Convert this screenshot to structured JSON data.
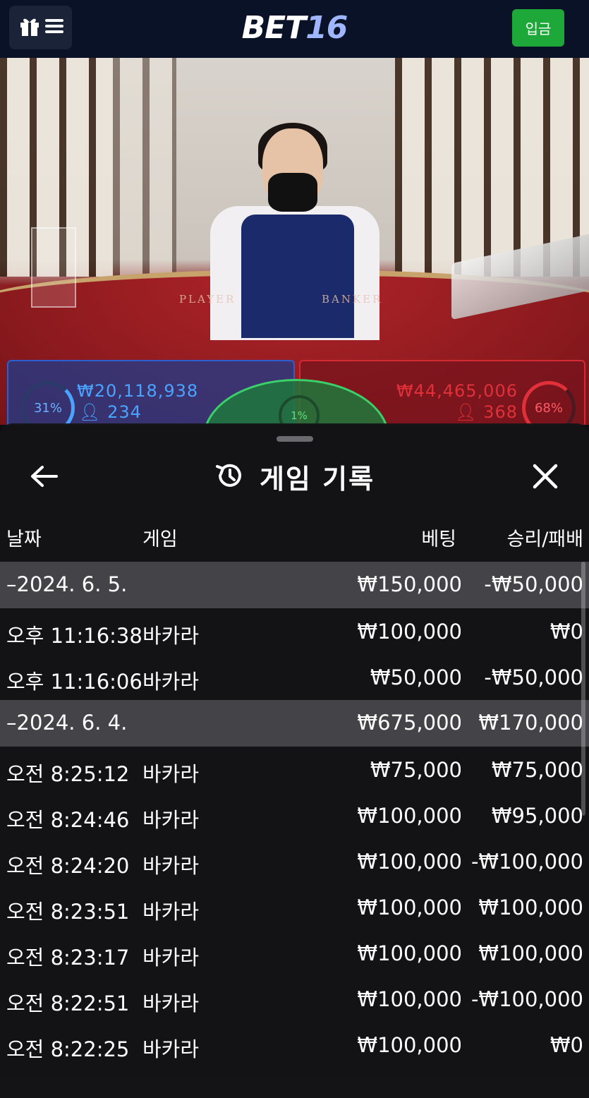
{
  "header": {
    "logo_text": "BET",
    "logo_num": "16",
    "deposit_label": "입금",
    "menu_icons": [
      "gift-icon",
      "hamburger-icon"
    ]
  },
  "video": {
    "table_player_text": "PLAYER",
    "table_banker_text": "BANKER",
    "player": {
      "percent": "31%",
      "amount": "₩20,118,938",
      "count": "234"
    },
    "banker": {
      "percent": "68%",
      "amount": "₩44,465,006",
      "count": "368"
    },
    "tie": {
      "percent": "1%"
    }
  },
  "modal": {
    "title": "게임 기록",
    "columns": {
      "date": "날짜",
      "game": "게임",
      "bet": "베팅",
      "result": "승리/패배"
    },
    "rows": [
      {
        "type": "date",
        "time": "–2024. 6. 5.",
        "game": "",
        "bet": "₩150,000",
        "result": "-₩50,000"
      },
      {
        "type": "item",
        "time": "오후 11:16:38",
        "game": "바카라",
        "bet": "₩100,000",
        "result": "₩0"
      },
      {
        "type": "item",
        "time": "오후 11:16:06",
        "game": "바카라",
        "bet": "₩50,000",
        "result": "-₩50,000"
      },
      {
        "type": "date",
        "time": "–2024. 6. 4.",
        "game": "",
        "bet": "₩675,000",
        "result": "₩170,000"
      },
      {
        "type": "item",
        "time": "오전 8:25:12",
        "game": "바카라",
        "bet": "₩75,000",
        "result": "₩75,000"
      },
      {
        "type": "item",
        "time": "오전 8:24:46",
        "game": "바카라",
        "bet": "₩100,000",
        "result": "₩95,000"
      },
      {
        "type": "item",
        "time": "오전 8:24:20",
        "game": "바카라",
        "bet": "₩100,000",
        "result": "-₩100,000"
      },
      {
        "type": "item",
        "time": "오전 8:23:51",
        "game": "바카라",
        "bet": "₩100,000",
        "result": "₩100,000"
      },
      {
        "type": "item",
        "time": "오전 8:23:17",
        "game": "바카라",
        "bet": "₩100,000",
        "result": "₩100,000"
      },
      {
        "type": "item",
        "time": "오전 8:22:51",
        "game": "바카라",
        "bet": "₩100,000",
        "result": "-₩100,000"
      },
      {
        "type": "item",
        "time": "오전 8:22:25",
        "game": "바카라",
        "bet": "₩100,000",
        "result": "₩0"
      }
    ]
  },
  "colors": {
    "topbar": "#0a1228",
    "deposit_green": "#1ea83a",
    "player_blue": "#2d5fd0",
    "banker_red": "#d42a33",
    "tie_green": "#3bd06a",
    "date_row": "#5a5a5e"
  }
}
